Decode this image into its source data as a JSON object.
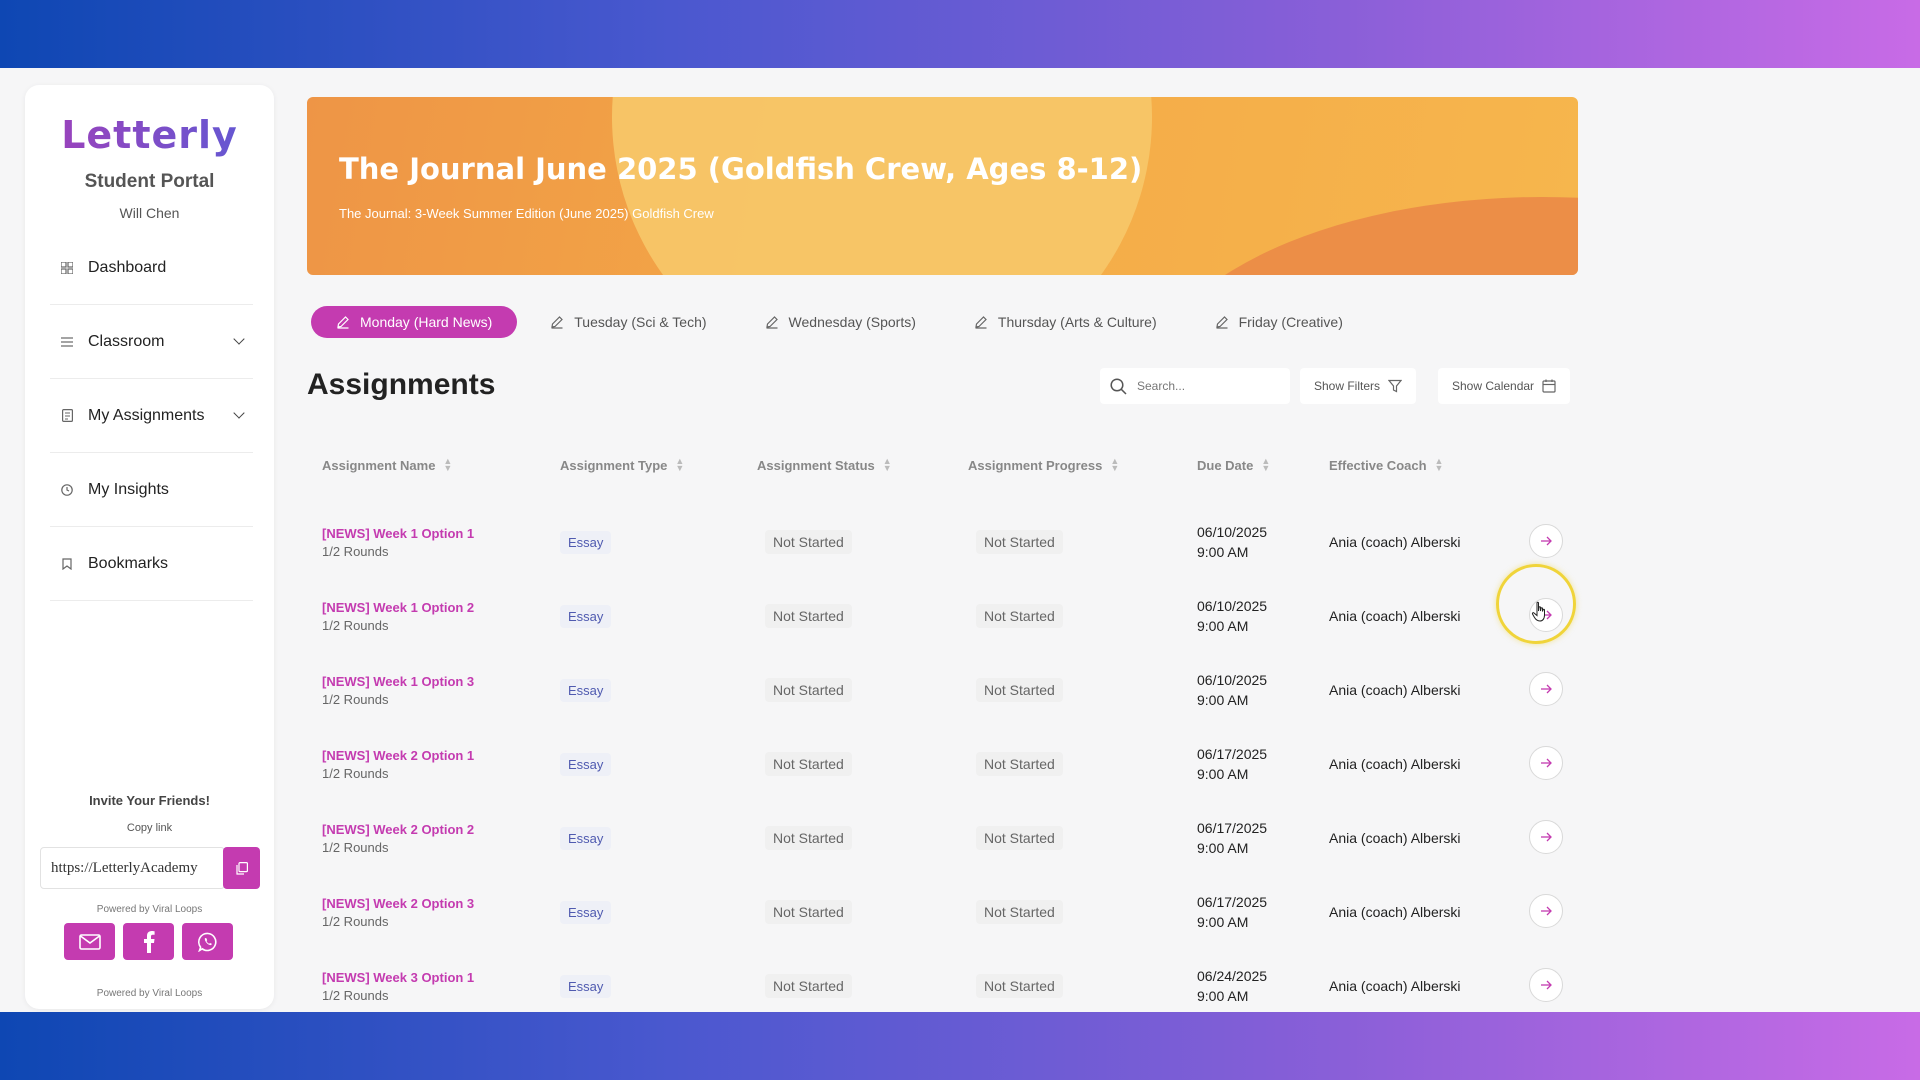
{
  "brand": {
    "logo": "Letterly",
    "accent": "#c43bb0"
  },
  "sidebar": {
    "portal_title": "Student Portal",
    "user_name": "Will Chen",
    "items": [
      {
        "label": "Dashboard",
        "icon": "grid-icon",
        "has_chevron": false
      },
      {
        "label": "Classroom",
        "icon": "list-icon",
        "has_chevron": true
      },
      {
        "label": "My Assignments",
        "icon": "document-icon",
        "has_chevron": true
      },
      {
        "label": "My Insights",
        "icon": "clock-icon",
        "has_chevron": false
      },
      {
        "label": "Bookmarks",
        "icon": "bookmark-icon",
        "has_chevron": false
      }
    ],
    "invite": {
      "title": "Invite Your Friends!",
      "copy_label": "Copy link",
      "link_value": "https://LetterlyAcademy",
      "powered_by": "Powered by Viral Loops"
    }
  },
  "banner": {
    "title": "The Journal June 2025 (Goldfish Crew, Ages 8-12)",
    "subtitle": "The Journal: 3-Week Summer Edition (June 2025) Goldfish Crew"
  },
  "tabs": [
    {
      "label": "Monday (Hard News)",
      "active": true
    },
    {
      "label": "Tuesday (Sci & Tech)",
      "active": false
    },
    {
      "label": "Wednesday (Sports)",
      "active": false
    },
    {
      "label": "Thursday (Arts & Culture)",
      "active": false
    },
    {
      "label": "Friday (Creative)",
      "active": false
    }
  ],
  "assignments": {
    "title": "Assignments",
    "search_placeholder": "Search...",
    "show_filters": "Show Filters",
    "show_calendar": "Show Calendar",
    "columns": [
      "Assignment Name",
      "Assignment Type",
      "Assignment Status",
      "Assignment Progress",
      "Due Date",
      "Effective Coach"
    ],
    "rows": [
      {
        "name": "[NEWS] Week 1 Option 1",
        "rounds": "1/2 Rounds",
        "type": "Essay",
        "status": "Not Started",
        "progress": "Not Started",
        "due_date": "06/10/2025",
        "due_time": "9:00 AM",
        "coach": "Ania (coach) Alberski"
      },
      {
        "name": "[NEWS] Week 1 Option 2",
        "rounds": "1/2 Rounds",
        "type": "Essay",
        "status": "Not Started",
        "progress": "Not Started",
        "due_date": "06/10/2025",
        "due_time": "9:00 AM",
        "coach": "Ania (coach) Alberski"
      },
      {
        "name": "[NEWS] Week 1 Option 3",
        "rounds": "1/2 Rounds",
        "type": "Essay",
        "status": "Not Started",
        "progress": "Not Started",
        "due_date": "06/10/2025",
        "due_time": "9:00 AM",
        "coach": "Ania (coach) Alberski"
      },
      {
        "name": "[NEWS] Week 2 Option 1",
        "rounds": "1/2 Rounds",
        "type": "Essay",
        "status": "Not Started",
        "progress": "Not Started",
        "due_date": "06/17/2025",
        "due_time": "9:00 AM",
        "coach": "Ania (coach) Alberski"
      },
      {
        "name": "[NEWS] Week 2 Option 2",
        "rounds": "1/2 Rounds",
        "type": "Essay",
        "status": "Not Started",
        "progress": "Not Started",
        "due_date": "06/17/2025",
        "due_time": "9:00 AM",
        "coach": "Ania (coach) Alberski"
      },
      {
        "name": "[NEWS] Week 2 Option 3",
        "rounds": "1/2 Rounds",
        "type": "Essay",
        "status": "Not Started",
        "progress": "Not Started",
        "due_date": "06/17/2025",
        "due_time": "9:00 AM",
        "coach": "Ania (coach) Alberski"
      },
      {
        "name": "[NEWS] Week 3 Option 1",
        "rounds": "1/2 Rounds",
        "type": "Essay",
        "status": "Not Started",
        "progress": "Not Started",
        "due_date": "06/24/2025",
        "due_time": "9:00 AM",
        "coach": "Ania (coach) Alberski"
      }
    ]
  }
}
